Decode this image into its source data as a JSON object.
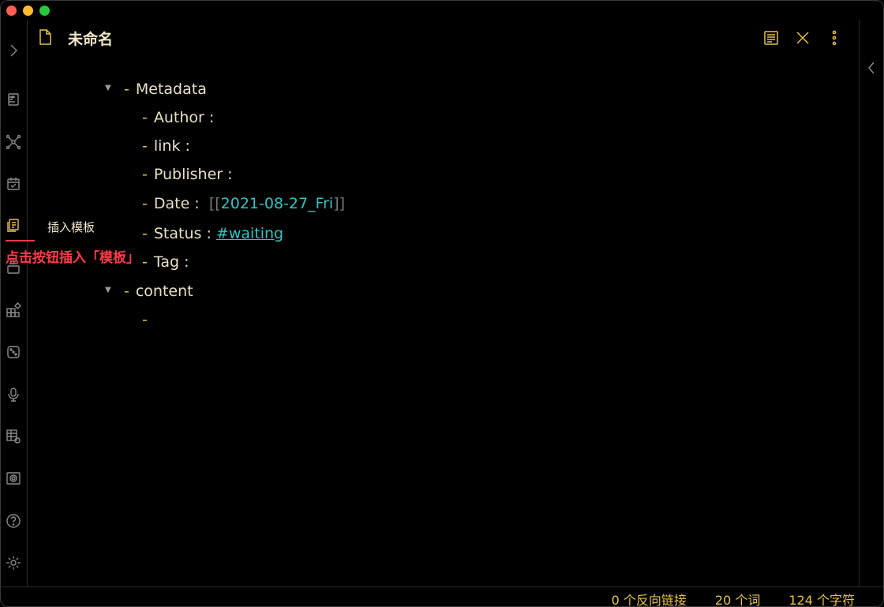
{
  "note": {
    "title": "未命名"
  },
  "header": {
    "actions": [
      "reading-view-icon",
      "close-icon",
      "more-options-icon"
    ]
  },
  "ribbon": {
    "icons": [
      "expand-sidebar-icon",
      "command-palette-icon",
      "graph-view-icon",
      "daily-note-icon",
      "insert-template-icon",
      "slides-icon",
      "plugins-grid-icon",
      "random-note-icon",
      "audio-recorder-icon",
      "table-settings-icon",
      "image-icon",
      "help-icon",
      "settings-icon"
    ],
    "active": "insert-template-icon"
  },
  "tooltip": "插入模板",
  "annotation": "点击按钮插入「模板」",
  "editor": {
    "bullet": "-",
    "metadata_label": "Metadata",
    "author_label": "Author :",
    "link_label": "link :",
    "publisher_label": "Publisher :",
    "date_label": "Date :",
    "date_open": "[[",
    "date_value": "2021-08-27_Fri",
    "date_close": "]]",
    "status_label": "Status :",
    "status_tag": "#waiting",
    "tag_label": "Tag :",
    "content_label": "content"
  },
  "status": {
    "backlinks": "0 个反向链接",
    "words": "20 个词",
    "chars": "124 个字符"
  },
  "colors": {
    "accent": "#e5c349",
    "link": "#36c2c2",
    "annotation": "#ff3b4a",
    "background": "#000000"
  }
}
